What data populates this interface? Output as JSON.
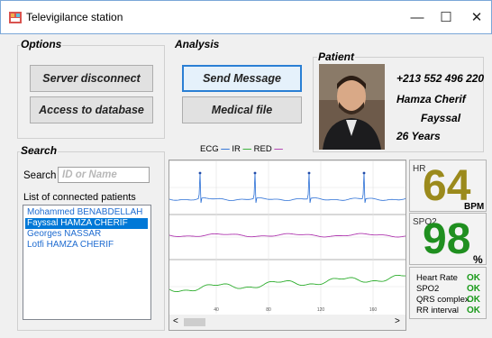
{
  "window": {
    "title": "Televigilance station",
    "minimize": "—",
    "maximize": "☐",
    "close": "✕"
  },
  "options": {
    "title": "Options",
    "server_disconnect": "Server disconnect",
    "access_database": "Access to database"
  },
  "analysis": {
    "title": "Analysis",
    "send_message": "Send Message",
    "medical_file": "Medical file"
  },
  "patient": {
    "title": "Patient",
    "phone": "+213 552 496 220",
    "last_name": "Hamza Cherif",
    "first_name": "Fayssal",
    "age": "26 Years"
  },
  "search": {
    "title": "Search",
    "label": "Search",
    "placeholder": "ID or Name",
    "list_label": "List of connected patients",
    "patients": [
      "Mohammed BENABDELLAH",
      "Fayssal HAMZA CHERIF",
      "Georges NASSAR",
      "Lotfi HAMZA CHERIF"
    ],
    "selected_index": 1
  },
  "legend": {
    "ecg": "ECG",
    "ir": "IR",
    "red": "RED",
    "ecg_color": "#2a6fd6",
    "ir_color": "#2fae2f",
    "red_color": "#b03ab0"
  },
  "chart_data": {
    "type": "line",
    "x_ticks": [
      "40",
      "80",
      "120",
      "160"
    ],
    "series": [
      {
        "name": "ECG",
        "color": "#2a6fd6"
      },
      {
        "name": "IR",
        "color": "#2fae2f"
      },
      {
        "name": "RED",
        "color": "#b03ab0"
      }
    ],
    "grid": true
  },
  "hr": {
    "label": "HR",
    "value": "64",
    "unit": "BPM",
    "color": "#9b8a1c"
  },
  "spo2": {
    "label": "SPO2",
    "value": "98",
    "unit": "%",
    "color": "#1f8f1f"
  },
  "status": [
    {
      "label": "Heart Rate",
      "value": "OK"
    },
    {
      "label": "SPO2",
      "value": "OK"
    },
    {
      "label": "QRS complex",
      "value": "OK"
    },
    {
      "label": "RR interval",
      "value": "OK"
    }
  ],
  "scroll": {
    "left": "<",
    "right": ">"
  }
}
